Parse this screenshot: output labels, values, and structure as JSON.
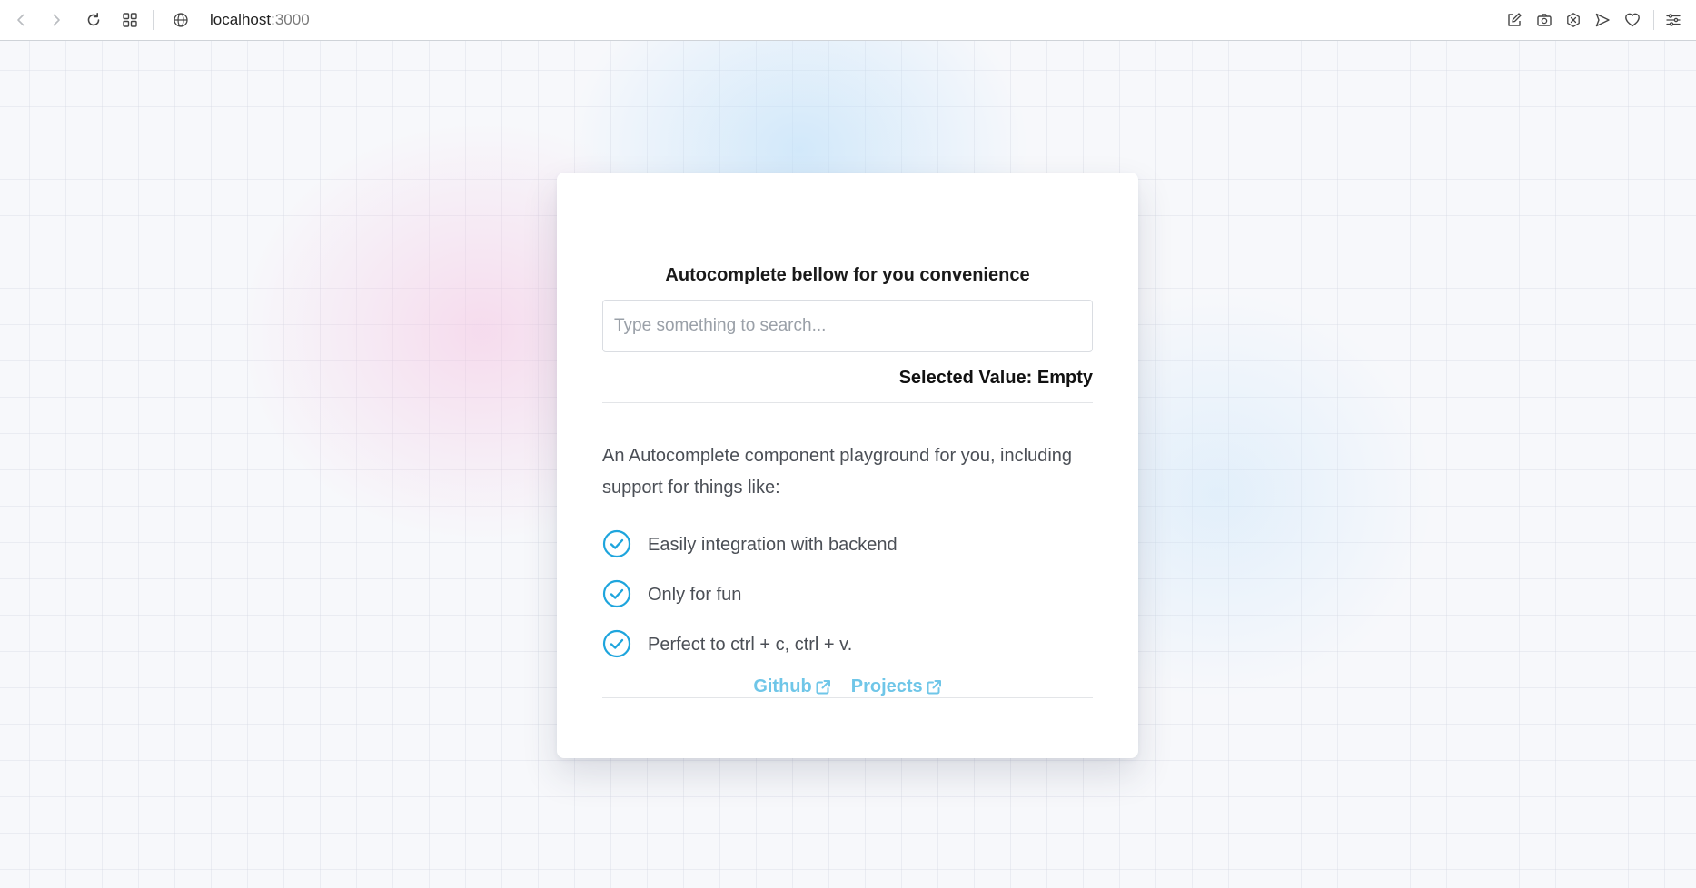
{
  "browser": {
    "url_host": "localhost",
    "url_port": ":3000"
  },
  "card": {
    "title": "Autocomplete bellow for you convenience",
    "search": {
      "placeholder": "Type something to search...",
      "value": ""
    },
    "selected_value": "Selected Value: Empty",
    "description": "An Autocomplete component playground for you, including support for things like:",
    "features": [
      {
        "label": "Easily integration with backend",
        "icon": "check-circle-icon"
      },
      {
        "label": "Only for fun",
        "icon": "check-circle-icon"
      },
      {
        "label": "Perfect to ctrl + c, ctrl + v.",
        "icon": "check-circle-icon"
      }
    ],
    "links": [
      {
        "label": "Github",
        "icon": "external-link-icon"
      },
      {
        "label": "Projects",
        "icon": "external-link-icon"
      }
    ]
  },
  "colors": {
    "accent": "#1ea5dd",
    "link": "#6fc6e8",
    "text": "#4b4f56"
  }
}
